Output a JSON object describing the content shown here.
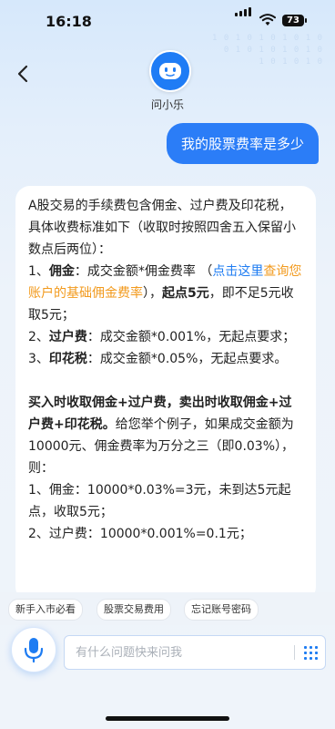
{
  "status_bar": {
    "time": "16:18",
    "battery": "73"
  },
  "header": {
    "assistant_name": "问小乐",
    "binary_pattern": [
      "1 0 1 0 1 0 1 0 1 0",
      "0 1 0 1 0 1 0 1 0",
      "1 0 1 0 1 0"
    ]
  },
  "user_message": "我的股票费率是多少",
  "bot_message": {
    "p1": "A股交易的手续费包含佣金、过户费及印花税，具体收费标准如下（收取时按照四舍五入保留小数点后两位）：",
    "item1_prefix": "1、",
    "item1_bold": "佣金",
    "item1_text": "：成交金额*佣金费率 （",
    "item1_link": "点击这里",
    "item1_link2": "查询您账户的基础佣金费率",
    "item1_close": "），",
    "item1_bold2": "起点5元",
    "item1_tail": "，即不足5元收取5元；",
    "item2_prefix": "2、",
    "item2_bold": "过户费",
    "item2_text": "：成交金额*0.001%，无起点要求；",
    "item3_prefix": "3、",
    "item3_bold": "印花税",
    "item3_text": "：成交金额*0.05%，无起点要求。",
    "p2_bold": "买入时收取佣金+过户费，卖出时收取佣金+过户费+印花税。",
    "p2_text": "给您举个例子，如果成交金额为10000元、佣金费率为万分之三（即0.03%），则：",
    "ex1": "1、佣金：10000*0.03%=3元，未到达5元起点，收取5元；",
    "ex2": "2、过户费：10000*0.001%=0.1元；"
  },
  "quick_replies": [
    "新手入市必看",
    "股票交易费用",
    "忘记账号密码"
  ],
  "input": {
    "placeholder": "有什么问题快来问我"
  },
  "colors": {
    "accent": "#2b7df7",
    "link_orange": "#f29a1d"
  }
}
